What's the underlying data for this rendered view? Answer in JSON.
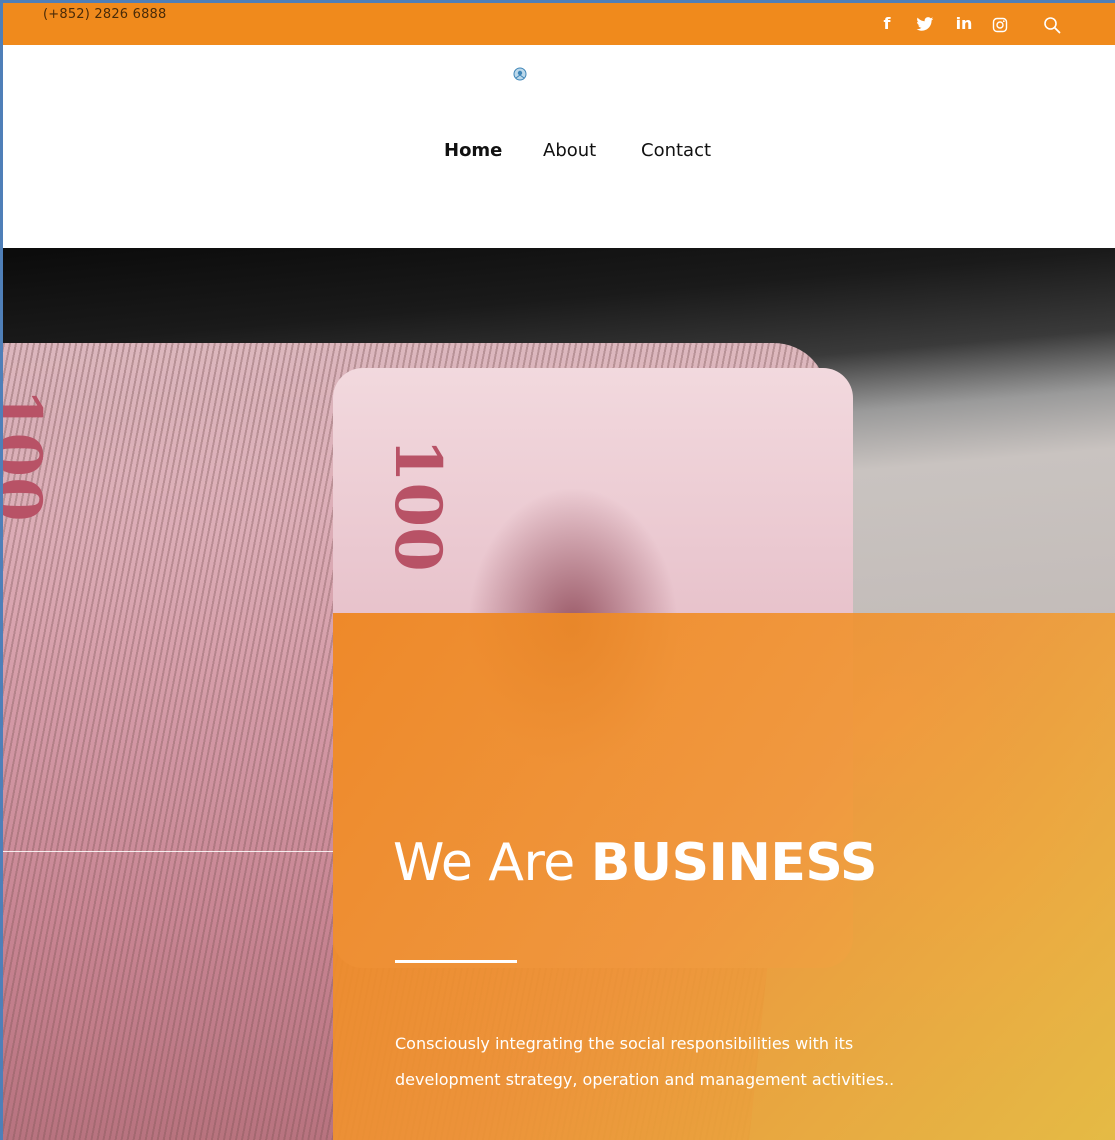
{
  "topbar": {
    "phone": "(+852) 2826 6888",
    "social": {
      "facebook": "f",
      "twitter_icon": "twitter-icon",
      "linkedin": "in",
      "instagram_icon": "instagram-icon",
      "search_icon": "search-icon"
    },
    "background": "#f08a1c"
  },
  "nav": {
    "items": [
      {
        "label": "Home",
        "active": true
      },
      {
        "label": "About",
        "active": false
      },
      {
        "label": "Contact",
        "active": false
      }
    ]
  },
  "hero": {
    "headline_light": "We Are ",
    "headline_bold": "BUSINESS",
    "subtext_line1": "Consciously integrating the social responsibilities with its",
    "subtext_line2": "development strategy, operation and management activities..",
    "overlay_color": "#ee841c",
    "note_value": "100"
  }
}
